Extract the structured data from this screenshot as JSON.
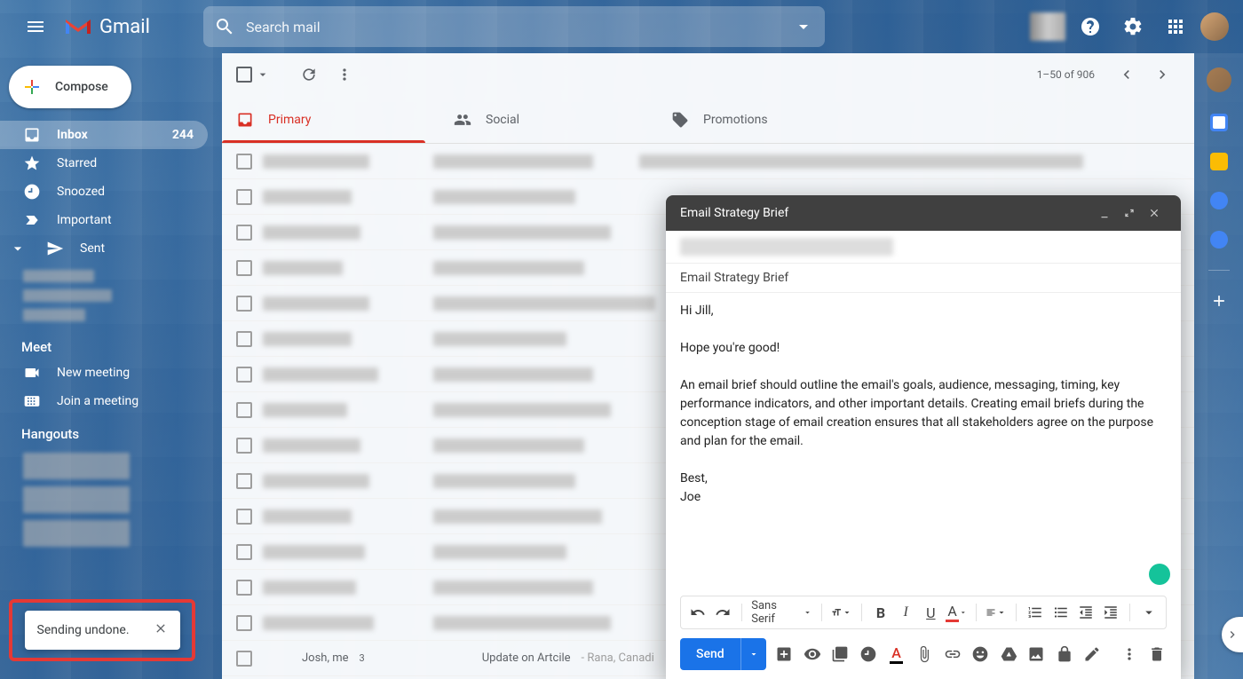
{
  "header": {
    "app_name": "Gmail",
    "search_placeholder": "Search mail"
  },
  "compose_button": "Compose",
  "sidebar": {
    "items": [
      {
        "label": "Inbox",
        "count": "244"
      },
      {
        "label": "Starred"
      },
      {
        "label": "Snoozed"
      },
      {
        "label": "Important"
      },
      {
        "label": "Sent"
      }
    ],
    "meet_title": "Meet",
    "meet_new": "New meeting",
    "meet_join": "Join a meeting",
    "hangouts_title": "Hangouts"
  },
  "toolbar": {
    "page_info": "1–50 of 906"
  },
  "tabs": {
    "primary": "Primary",
    "social": "Social",
    "promotions": "Promotions"
  },
  "visible_row": {
    "sender": "Josh, me",
    "count": "3",
    "subject": "Update on Artcile",
    "preview": " - Rana, Canadi"
  },
  "compose": {
    "title": "Email Strategy Brief",
    "subject": "Email Strategy Brief",
    "body_greeting": "Hi Jill,",
    "body_line1": "Hope you're good!",
    "body_para": "An email brief should outline the email's goals, audience, messaging, timing, key performance indicators, and other important details. Creating email briefs during the conception stage of email creation ensures that all stakeholders agree on the purpose and plan for the email.",
    "body_signoff1": "Best,",
    "body_signoff2": "Joe",
    "font_name": "Sans Serif",
    "send_label": "Send"
  },
  "toast": {
    "message": "Sending undone."
  }
}
